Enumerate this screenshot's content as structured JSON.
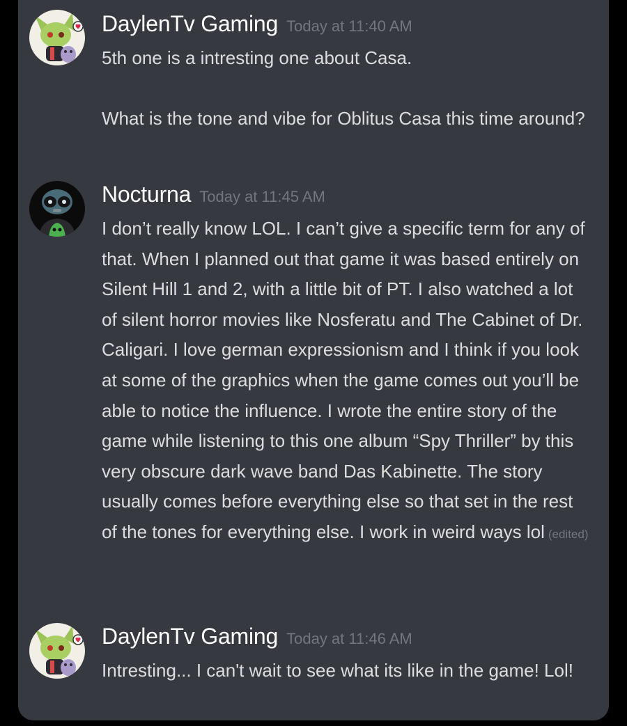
{
  "messages": [
    {
      "username": "DaylenTv Gaming",
      "timestamp": "Today at 11:40 AM",
      "paragraphs": [
        "5th one is a intresting one about Casa.",
        "What is the tone and vibe for Oblitus Casa this time around?"
      ],
      "avatar": "green-character-avatar"
    },
    {
      "username": "Nocturna",
      "timestamp": "Today at 11:45 AM",
      "paragraphs": [
        "I don’t really know LOL. I can’t give a specific term for any of that. When I planned out that game it was based entirely on Silent Hill 1 and 2, with a little bit of PT. I also watched a lot of silent horror movies like Nosferatu and The Cabinet of Dr. Caligari. I love german expressionism and I think if you look at some of the graphics when the game comes out you’ll be able to notice the influence. I wrote the entire story of the game while listening to this one album “Spy Thriller” by this very obscure dark wave band Das Kabinette. The story usually comes before everything else so that set in the rest of the tones for everything else. I work in weird ways lol"
      ],
      "edited": "(edited)",
      "avatar": "masked-character-avatar"
    },
    {
      "username": "DaylenTv Gaming",
      "timestamp": "Today at 11:46 AM",
      "paragraphs": [
        "Intresting... I can't wait to see what its like in the game! Lol!"
      ],
      "avatar": "green-character-avatar"
    }
  ],
  "colors": {
    "background": "#36393f",
    "outer": "#000000",
    "username": "#ffffff",
    "timestamp": "#72767d",
    "message_text": "#dcddde"
  }
}
